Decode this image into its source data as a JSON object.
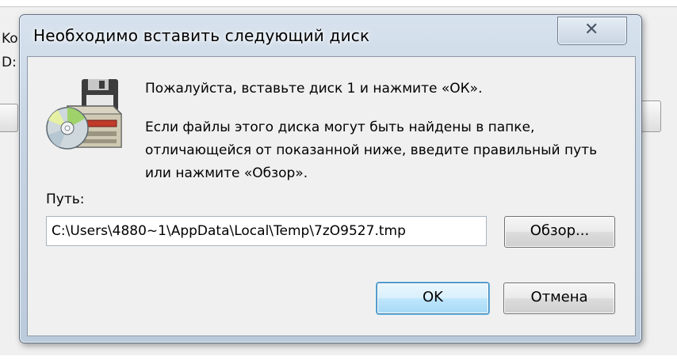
{
  "background_window": {
    "label_line_1": "Ko",
    "label_line_2": "D:"
  },
  "dialog": {
    "title": "Необходимо вставить следующий диск",
    "close_icon": "close-icon",
    "message_1": "Пожалуйста, вставьте диск 1 и нажмите «ОК».",
    "message_2": "Если файлы этого диска могут быть найдены в папке, отличающейся от показанной ниже, введите правильный путь или нажмите «Обзор».",
    "path_label": "Путь:",
    "path_value": "C:\\Users\\4880~1\\AppData\\Local\\Temp\\7zO9527.tmp",
    "browse_label": "Обзор...",
    "ok_label": "OK",
    "cancel_label": "Отмена",
    "icon": "disk-drive-icon"
  },
  "colors": {
    "frame": "#c6d3e2",
    "client": "#f0f0f0",
    "default_button": "#bee6fd"
  }
}
